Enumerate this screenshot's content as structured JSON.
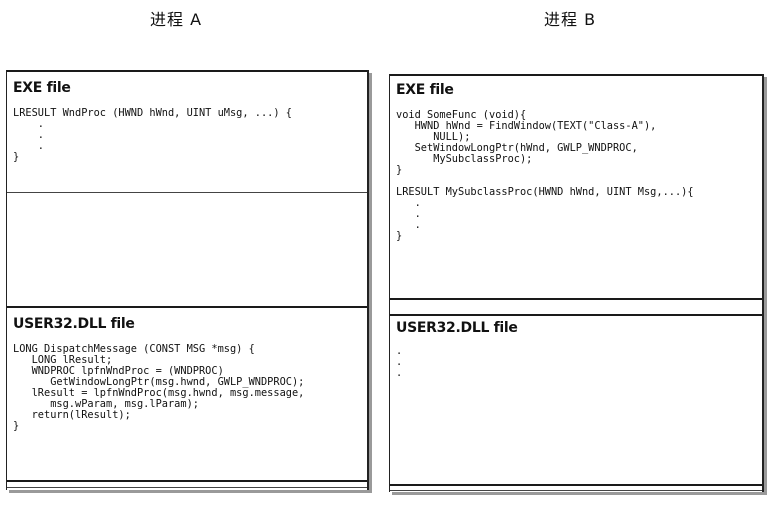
{
  "process_a": {
    "title": "进程 A",
    "exe": {
      "title": "EXE file",
      "code": "LRESULT WndProc (HWND hWnd, UINT uMsg, ...) {\n    .\n    .\n    .\n}"
    },
    "user32": {
      "title": "USER32.DLL file",
      "code": "LONG DispatchMessage (CONST MSG *msg) {\n   LONG lResult;\n   WNDPROC lpfnWndProc = (WNDPROC)\n      GetWindowLongPtr(msg.hwnd, GWLP_WNDPROC);\n   lResult = lpfnWndProc(msg.hwnd, msg.message,\n      msg.wParam, msg.lParam);\n   return(lResult);\n}"
    }
  },
  "process_b": {
    "title": "进程 B",
    "exe": {
      "title": "EXE file",
      "code": "void SomeFunc (void){\n   HWND hWnd = FindWindow(TEXT(\"Class-A\"),\n      NULL);\n   SetWindowLongPtr(hWnd, GWLP_WNDPROC,\n      MySubclassProc);\n}\n\nLRESULT MySubclassProc(HWND hWnd, UINT Msg,...){\n   .\n   .\n   .\n}"
    },
    "user32": {
      "title": "USER32.DLL file",
      "code": ".\n.\n."
    }
  }
}
